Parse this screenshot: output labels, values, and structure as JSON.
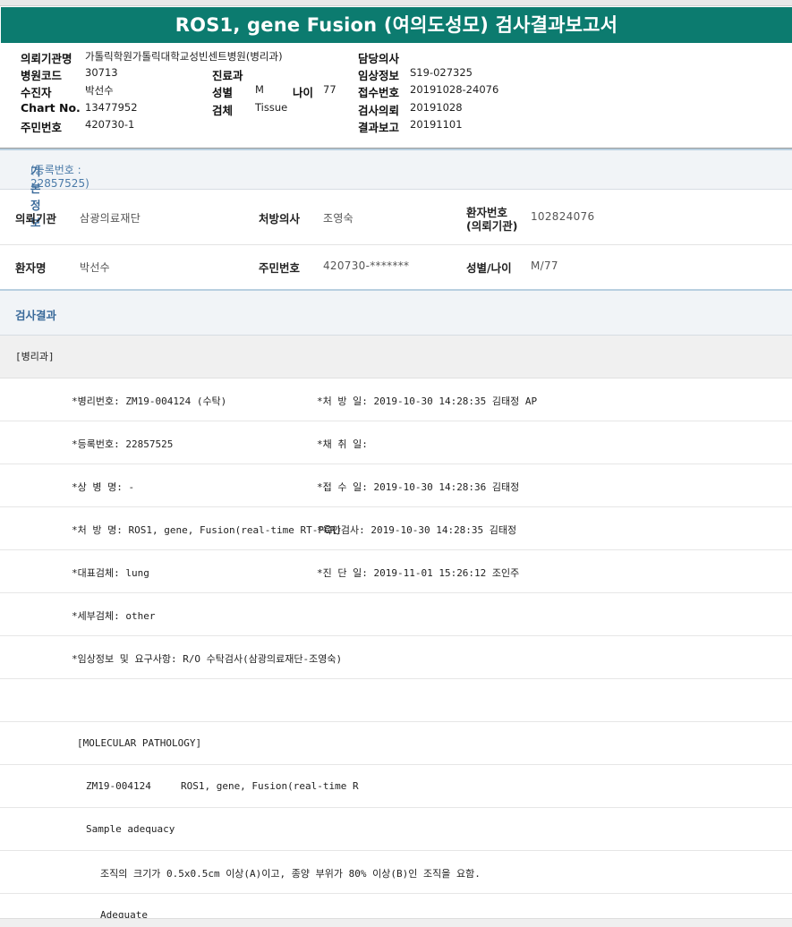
{
  "title": "ROS1, gene Fusion (여의도성모) 검사결과보고서",
  "header": {
    "requesting_institution_label": "의뢰기관명",
    "requesting_institution": "가톨릭학원가톨릭대학교성빈센트병원(병리과)",
    "hospital_code_label": "병원코드",
    "hospital_code": "30713",
    "receiver_label": "수진자",
    "receiver": "박선수",
    "chart_no_label": "Chart No.",
    "chart_no": "13477952",
    "resident_no_label": "주민번호",
    "resident_no": "420730-1",
    "department_label": "진료과",
    "department": "",
    "sex_label": "성별",
    "sex": "M",
    "age_label": "나이",
    "age": "77",
    "specimen_label": "검체",
    "specimen": "Tissue",
    "doctor_label": "담당의사",
    "doctor": "",
    "clinical_info_label": "임상정보",
    "clinical_info": "S19-027325",
    "accession_label": "접수번호",
    "accession": "20191028-24076",
    "request_date_label": "검사의뢰",
    "request_date": "20191028",
    "report_date_label": "결과보고",
    "report_date": "20191101"
  },
  "basic_info": {
    "heading": "기본정보",
    "registration": "(등록번호 : 22857525)",
    "institution_label": "의뢰기관",
    "institution": "삼광의료재단",
    "prescriber_label": "처방의사",
    "prescriber": "조영숙",
    "patient_no_label_1": "환자번호",
    "patient_no_label_2": "(의뢰기관)",
    "patient_no": "102824076",
    "patient_name_label": "환자명",
    "patient_name": "박선수",
    "resident_label": "주민번호",
    "resident": "420730-*******",
    "sex_age_label": "성별/나이",
    "sex_age": "M/77"
  },
  "results": {
    "heading": "검사결과",
    "dept": "[병리과]",
    "rows": [
      {
        "left": "*병리번호: ZM19-004124 (수탁)",
        "right": "*처 방 일: 2019-10-30 14:28:35  김태정 AP"
      },
      {
        "left": "*등록번호: 22857525",
        "right": "*채 취 일:"
      },
      {
        "left": "*상 병 명: -",
        "right": "*접 수 일: 2019-10-30 14:28:36  김태정"
      },
      {
        "left": "*처 방 명: ROS1, gene, Fusion(real-time RT-PCR)",
        "right": "*육안검사: 2019-10-30 14:28:35  김태정"
      },
      {
        "left": "*대표검체: lung",
        "right": "*진 단 일: 2019-11-01 15:26:12  조인주"
      },
      {
        "left": "*세부검체: other",
        "right": ""
      },
      {
        "left": "*임상정보 및 요구사항: R/O 수탁검사(삼광의료재단-조영숙)",
        "right": ""
      }
    ],
    "molecular_heading": "[MOLECULAR PATHOLOGY]",
    "molecular_id": "ZM19-004124     ROS1, gene, Fusion(real-time R",
    "sample_adequacy": "Sample adequacy",
    "criteria": "조직의 크기가 0.5x0.5cm 이상(A)이고, 종양 부위가 80% 이상(B)인 조직을 요함.",
    "adequacy_value": "Adequate"
  }
}
